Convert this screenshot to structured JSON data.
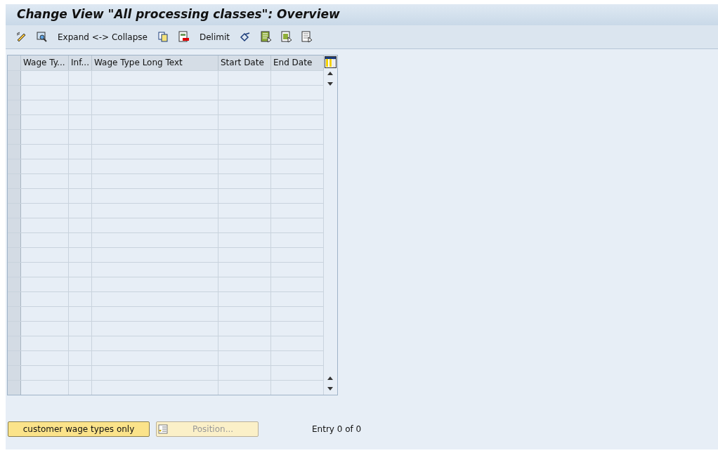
{
  "window": {
    "title": "Change View \"All processing classes\": Overview"
  },
  "toolbar": [
    {
      "kind": "icon"
    },
    {
      "kind": "icon"
    },
    {
      "kind": "text",
      "label": "Expand <-> Collapse"
    },
    {
      "kind": "icon"
    },
    {
      "kind": "icon"
    },
    {
      "kind": "text",
      "label": "Delimit"
    },
    {
      "kind": "icon"
    },
    {
      "kind": "icon"
    },
    {
      "kind": "icon"
    },
    {
      "kind": "icon"
    }
  ],
  "table": {
    "columns": [
      "Wage Ty...",
      "Inf...",
      "Wage Type Long Text",
      "Start Date",
      "End Date"
    ]
  },
  "footer": {
    "buttons": [
      {
        "label": "customer wage types only",
        "disabled": false
      },
      {
        "label": "Position...",
        "disabled": true
      }
    ],
    "entry": "Entry 0 of 0"
  }
}
